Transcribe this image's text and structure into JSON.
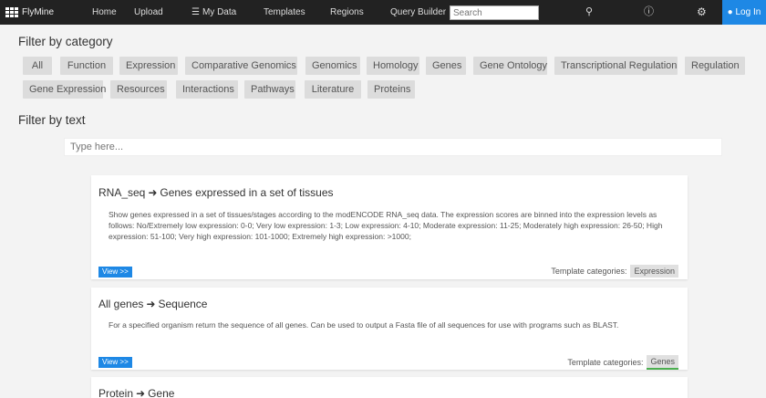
{
  "nav": {
    "brand": "FlyMine",
    "items": [
      "Home",
      "Upload",
      "My Data",
      "Templates",
      "Regions",
      "Query Builder"
    ],
    "search_placeholder": "Search",
    "login": "Log In"
  },
  "filters": {
    "category_heading": "Filter by category",
    "categories": [
      "All",
      "Function",
      "Expression",
      "Comparative Genomics",
      "Genomics",
      "Homology",
      "Genes",
      "Gene Ontology",
      "Transcriptional Regulation",
      "Regulation",
      "Gene Expression",
      "Resources",
      "Interactions",
      "Pathways",
      "Literature",
      "Proteins"
    ],
    "text_heading": "Filter by text",
    "text_placeholder": "Type here..."
  },
  "templates": [
    {
      "from": "RNA_seq",
      "to": "Genes expressed in a set of tissues",
      "description": "Show genes expressed in a set of tissues/stages according to the modENCODE RNA_seq data. The expression scores are binned into the expression levels as follows: No/Extremely low expression: 0-0; Very low expression: 1-3; Low expression: 4-10; Moderate expression: 11-25; Moderately high expression: 26-50; High expression: 51-100; Very high expression: 101-1000; Extremely high expression: >1000;",
      "view_label": "View >>",
      "categories_label": "Template categories:",
      "category": "Expression"
    },
    {
      "from": "All genes",
      "to": "Sequence",
      "description": "For a specified organism return the sequence of all genes. Can be used to output a Fasta file of all sequences for use with programs such as BLAST.",
      "view_label": "View >>",
      "categories_label": "Template categories:",
      "category": "Genes"
    },
    {
      "from": "Protein",
      "to": "Gene"
    }
  ]
}
